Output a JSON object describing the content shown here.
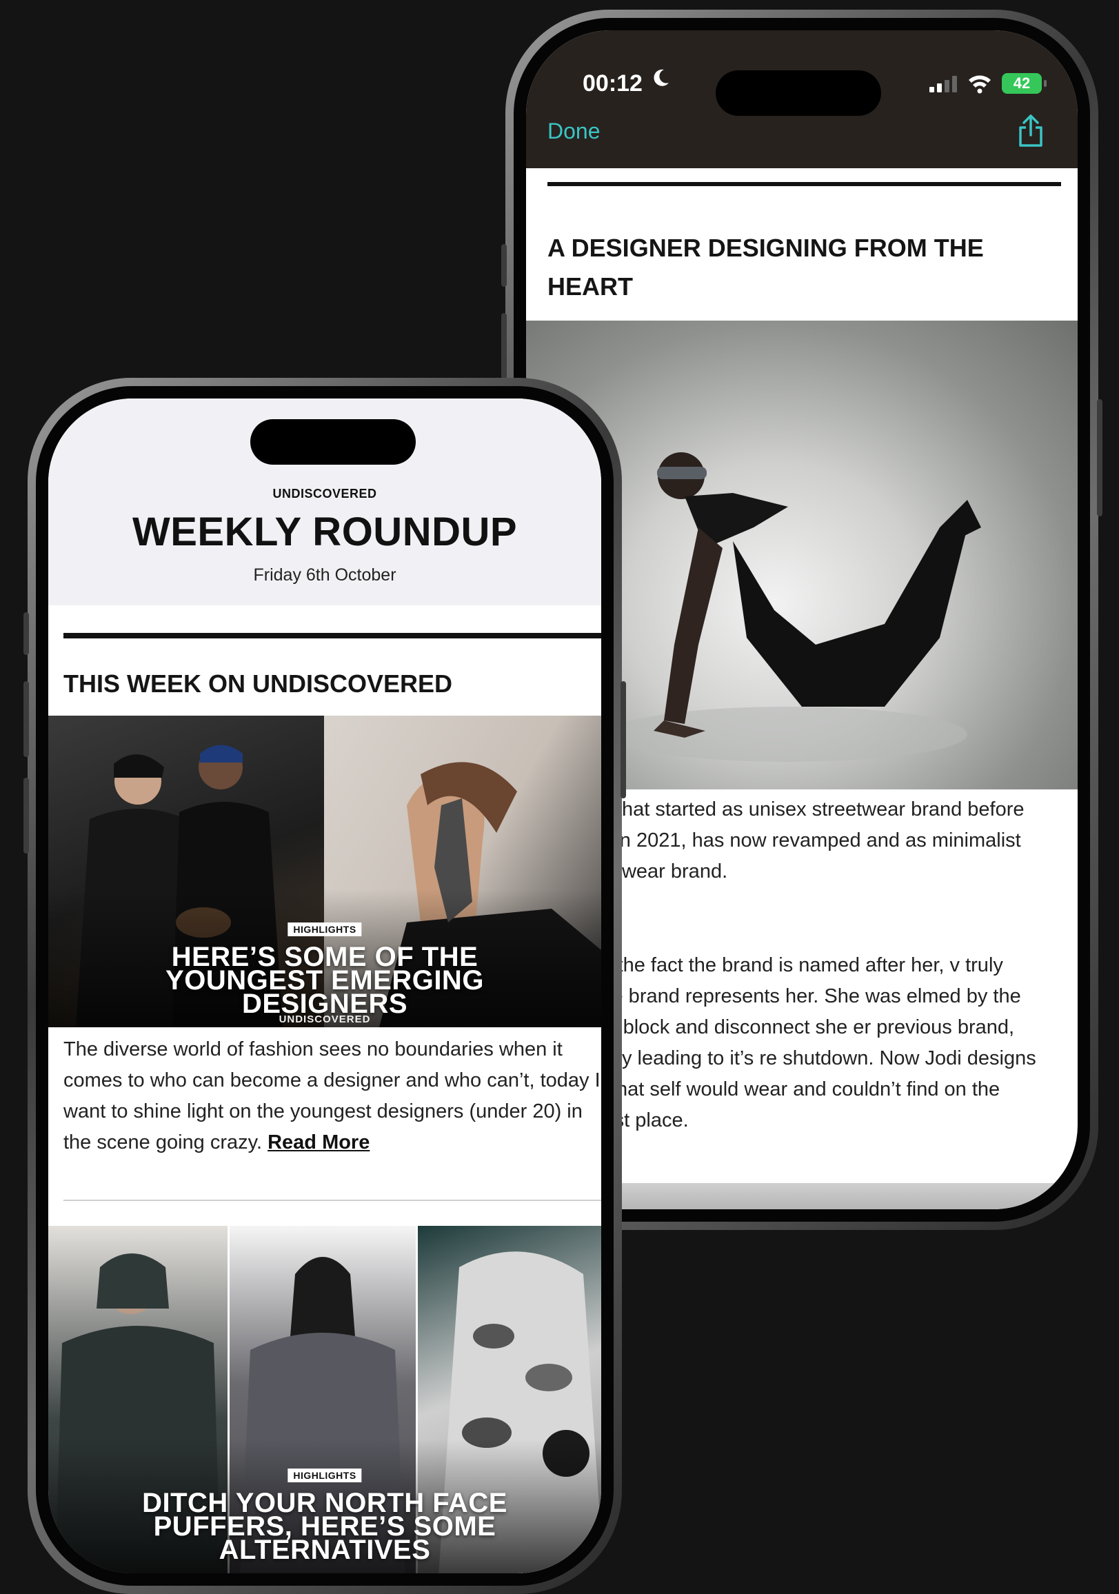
{
  "back_phone": {
    "status": {
      "time": "00:12",
      "battery": "42"
    },
    "nav": {
      "done_label": "Done"
    },
    "title": "A DESIGNER DESIGNING FROM THE HEART",
    "paragraph1": "essa - what started as unisex streetwear brand before closing in 2021, has now revamped and as minimalist womenswear brand.",
    "paragraph2": "om just the fact the brand is named after her, v truly feels the brand represents her. She was elmed by the creative block and disconnect she er previous brand, ultimately leading to it’s re shutdown. Now Jodi designs pieces that self would wear and couldn’t find on the market st place."
  },
  "front_phone": {
    "brand": "UNDISCOVERED",
    "headline": "WEEKLY ROUNDUP",
    "date": "Friday 6th October",
    "section_title": "THIS WEEK ON UNDISCOVERED",
    "feature": {
      "pill": "HIGHLIGHTS",
      "title_line1": "HERE’S SOME OF THE",
      "title_line2": "YOUNGEST EMERGING",
      "title_line3": "DESIGNERS",
      "brand": "UNDISCOVERED"
    },
    "body_text": "The diverse world of fashion sees no boundaries when it comes to who can become a designer and who can’t, today I want to shine light on the youngest designers (under 20) in the scene going crazy.",
    "read_more": "Read More",
    "second": {
      "pill": "HIGHLIGHTS",
      "title_line1": "DITCH YOUR NORTH FACE",
      "title_line2": "PUFFERS, HERE’S SOME",
      "title_line3": "ALTERNATIVES"
    }
  },
  "colors": {
    "accent": "#3bc5c5",
    "battery": "#35c759",
    "background": "#141414"
  },
  "icons": [
    "moon-icon",
    "signal-icon",
    "wifi-icon",
    "share-icon"
  ]
}
